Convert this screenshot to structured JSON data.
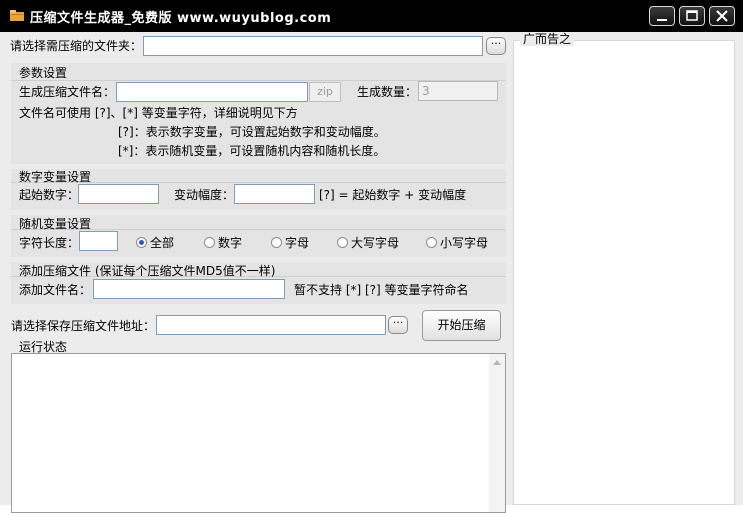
{
  "window": {
    "title": "压缩文件生成器_免费版 www.wuyublog.com",
    "controls": [
      "minimize",
      "maximize",
      "close"
    ]
  },
  "folder": {
    "label": "请选择需压缩的文件夹：",
    "value": "",
    "browse_label": "···"
  },
  "params": {
    "group_title": "参数设置",
    "filename_label": "生成压缩文件名：",
    "filename_value": "",
    "extension": "zip",
    "count_label": "生成数量：",
    "count_value": "3",
    "hint1": "文件名可使用 [?]、[*] 等变量字符，详细说明见下方",
    "hint2": "[?]：表示数字变量，可设置起始数字和变动幅度。",
    "hint3": "[*]：表示随机变量，可设置随机内容和随机长度。"
  },
  "numeric": {
    "group_title": "数字变量设置",
    "start_label": "起始数字：",
    "start_value": "",
    "step_label": "变动幅度：",
    "step_value": "",
    "formula": "[?] = 起始数字 + 变动幅度"
  },
  "random": {
    "group_title": "随机变量设置",
    "length_label": "字符长度：",
    "length_value": "",
    "options": [
      {
        "label": "全部",
        "selected": true
      },
      {
        "label": "数字",
        "selected": false
      },
      {
        "label": "字母",
        "selected": false
      },
      {
        "label": "大写字母",
        "selected": false
      },
      {
        "label": "小写字母",
        "selected": false
      }
    ]
  },
  "addfile": {
    "group_title": "添加压缩文件 (保证每个压缩文件MD5值不一样)",
    "name_label": "添加文件名：",
    "name_value": "",
    "note": "暂不支持 [*] [?] 等变量字符命名"
  },
  "save": {
    "label": "请选择保存压缩文件地址：",
    "value": "",
    "browse_label": "···",
    "start_button": "开始压缩"
  },
  "status": {
    "title": "运行状态",
    "content": ""
  },
  "ad": {
    "title": "广而告之"
  },
  "colors": {
    "titlebar": "#000000",
    "client_bg": "#ececec",
    "radio_dot": "#2b5bbf"
  }
}
